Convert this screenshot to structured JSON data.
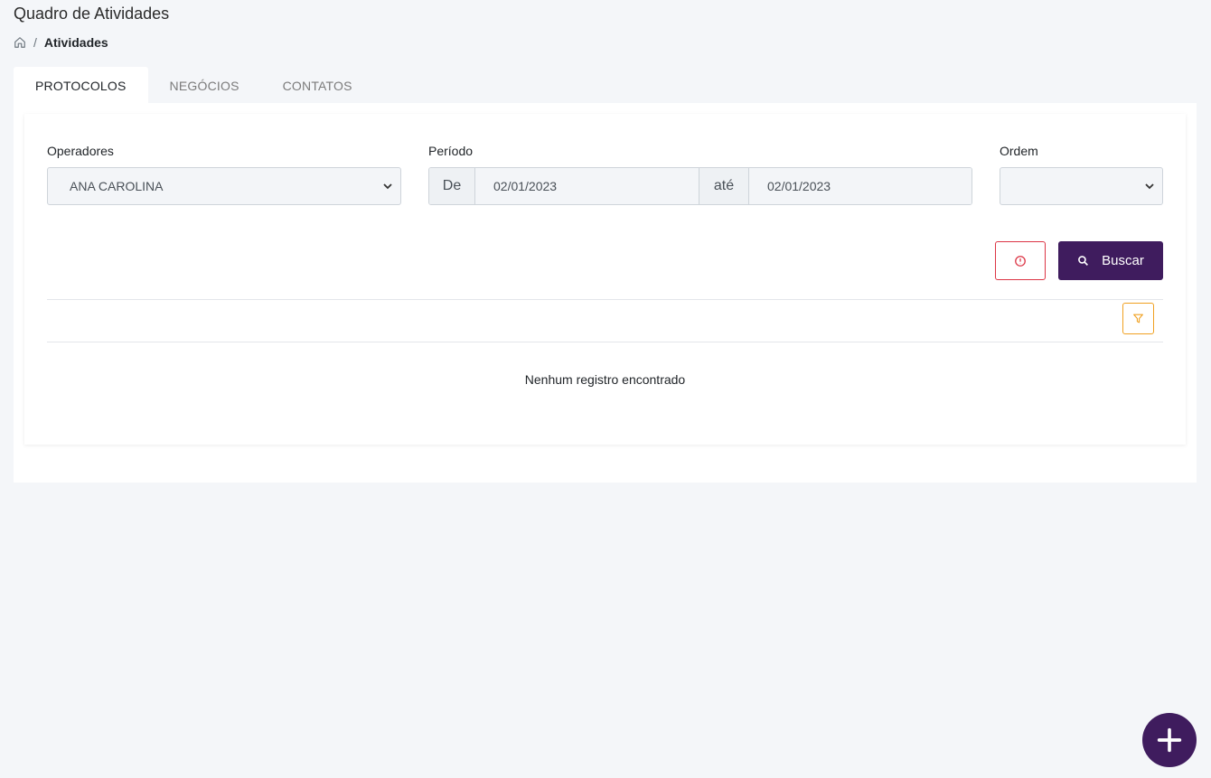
{
  "header": {
    "title": "Quadro de Atividades"
  },
  "breadcrumb": {
    "home_icon": "home-icon",
    "separator": "/",
    "current": "Atividades"
  },
  "tabs": [
    {
      "label": "PROTOCOLOS",
      "active": true
    },
    {
      "label": "NEGÓCIOS",
      "active": false
    },
    {
      "label": "CONTATOS",
      "active": false
    }
  ],
  "filters": {
    "operadores": {
      "label": "Operadores",
      "value": "ANA CAROLINA"
    },
    "periodo": {
      "label": "Período",
      "from_prefix": "De",
      "from_value": "02/01/2023",
      "to_prefix": "até",
      "to_value": "02/01/2023"
    },
    "ordem": {
      "label": "Ordem",
      "value": ""
    }
  },
  "actions": {
    "alert_icon": "alert-circle-icon",
    "search_label": "Buscar",
    "search_icon": "search-icon",
    "filter_icon": "filter-icon"
  },
  "results": {
    "empty_message": "Nenhum registro encontrado"
  },
  "fab": {
    "icon": "plus-icon"
  },
  "colors": {
    "primary": "#3f1c5e",
    "danger": "#dc3545",
    "warning": "#f0a020",
    "background": "#f4f6f9"
  }
}
